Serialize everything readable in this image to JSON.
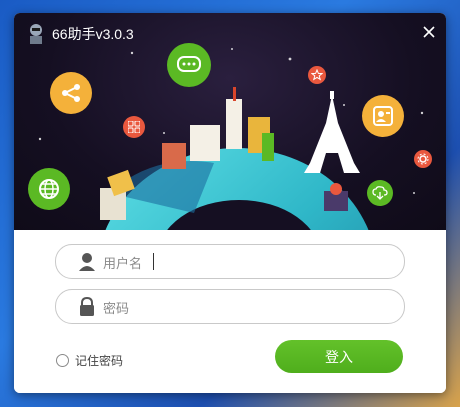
{
  "window": {
    "title": "66助手v3.0.3"
  },
  "login": {
    "username_placeholder": "用户名",
    "password_placeholder": "密码",
    "remember_label": "记住密码",
    "login_label": "登入"
  },
  "colors": {
    "accent": "#5bb924",
    "hero_bg": "#150f22",
    "border": "#c9c9c9"
  },
  "icons": [
    "app-logo-icon",
    "close-icon",
    "share-icon",
    "chat-icon",
    "star-icon",
    "profile-card-icon",
    "grid-icon",
    "gear-icon",
    "globe-icon",
    "cloud-download-icon",
    "user-icon",
    "lock-icon"
  ]
}
